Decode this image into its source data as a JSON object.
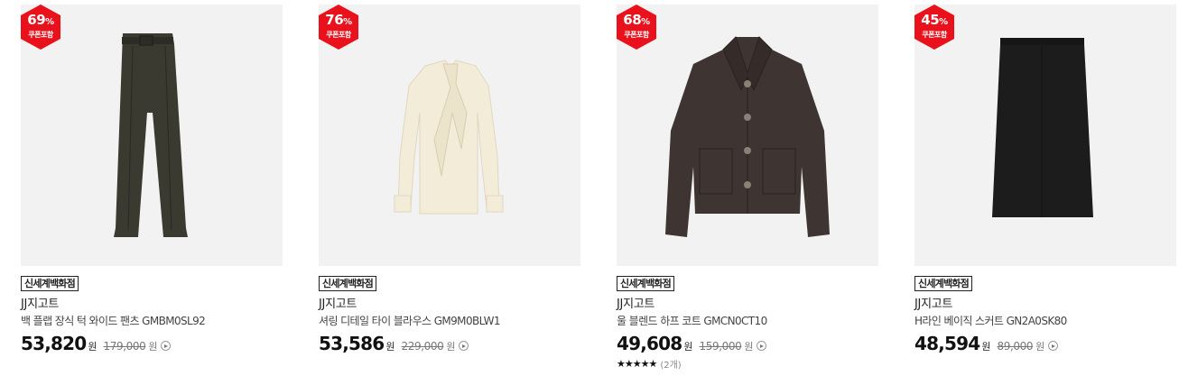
{
  "products": [
    {
      "discount": "69",
      "percent_sign": "%",
      "coupon_label": "쿠폰포함",
      "store": "신세계백화점",
      "brand": "JJ지고트",
      "name": "백 플랩 장식 턱 와이드 팬츠 GMBM0SL92",
      "price": "53,820",
      "won": "원",
      "original_price": "179,000",
      "image_icon": "trousers-icon",
      "image_color": "#3b3a30"
    },
    {
      "discount": "76",
      "percent_sign": "%",
      "coupon_label": "쿠폰포함",
      "store": "신세계백화점",
      "brand": "JJ지고트",
      "name": "셔링 디테일 타이 블라우스 GM9M0BLW1",
      "price": "53,586",
      "won": "원",
      "original_price": "229,000",
      "image_icon": "blouse-icon",
      "image_color": "#f3ecd9"
    },
    {
      "discount": "68",
      "percent_sign": "%",
      "coupon_label": "쿠폰포함",
      "store": "신세계백화점",
      "brand": "JJ지고트",
      "name": "울 블렌드 하프 코트 GMCN0CT10",
      "price": "49,608",
      "won": "원",
      "original_price": "159,000",
      "stars": "★★★★★",
      "review_count": "(2개)",
      "image_icon": "coat-icon",
      "image_color": "#3e3431"
    },
    {
      "discount": "45",
      "percent_sign": "%",
      "coupon_label": "쿠폰포함",
      "store": "신세계백화점",
      "brand": "JJ지고트",
      "name": "H라인 베이직 스커트 GN2A0SK80",
      "price": "48,594",
      "won": "원",
      "original_price": "89,000",
      "image_icon": "skirt-icon",
      "image_color": "#1c1c1c"
    }
  ],
  "colors": {
    "badge_red": "#e8111c",
    "thumb_bg": "#f2f2f2"
  }
}
